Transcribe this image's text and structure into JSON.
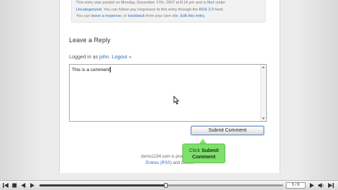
{
  "post_meta": {
    "line1": "This entry was posted on Monday, December 17th, 2007 at 8:14 pm and is filed under",
    "line2_category": "Uncategorized",
    "line2_text": ". You can follow any responses to this entry through the ",
    "line2_rss": "RSS 2.0",
    "line2_end": " feed.",
    "line3_start": "You can ",
    "line3_response": "leave a response",
    "line3_or": ", or ",
    "line3_trackback": "trackback",
    "line3_text": " from your own site. ",
    "line3_edit": "Edit this entry."
  },
  "reply": {
    "title": "Leave a Reply",
    "logged_in_prefix": "Logged in as ",
    "user": "john",
    "separator": ". ",
    "logout": "Logout »",
    "comment_text": "This is a comment"
  },
  "submit": {
    "label": "Submit Comment"
  },
  "footer": {
    "line1": "demo1234.com is proudly pow",
    "entries_rss": "Entries (RSS)",
    "and": " and ",
    "comments_partial": "Comm"
  },
  "callout": {
    "prefix": "Click ",
    "strong1": "Submit",
    "strong2": "Comment"
  },
  "player": {
    "page_counter": "5 / 8",
    "progress": 0.52
  },
  "colors": {
    "link": "#2a6ebb",
    "callout": "#7fe06b"
  }
}
